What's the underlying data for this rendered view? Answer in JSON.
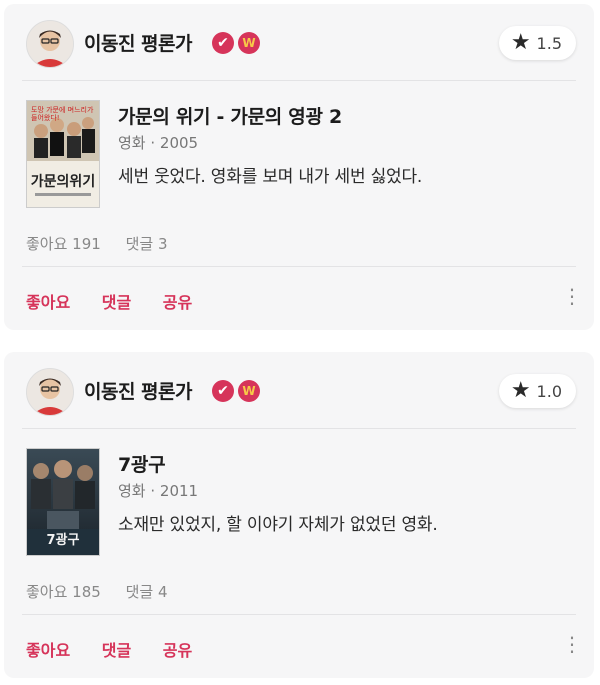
{
  "reviews": [
    {
      "author": "이동진 평론가",
      "badge_check": "✔",
      "badge_w": "W",
      "rating": "1.5",
      "movie_title": "가문의 위기 - 가문의 영광 2",
      "movie_meta": "영화 · 2005",
      "review_text": "세번 웃었다. 영화를 보며 내가 세번 싫었다.",
      "likes_label": "좋아요 191",
      "comments_label": "댓글 3",
      "poster_title": "가문의위기",
      "poster_tagline": "도망 가문에 며느리가 들어왔다!"
    },
    {
      "author": "이동진 평론가",
      "badge_check": "✔",
      "badge_w": "W",
      "rating": "1.0",
      "movie_title": "7광구",
      "movie_meta": "영화 · 2011",
      "review_text": "소재만 있었지, 할 이야기 자체가 없었던 영화.",
      "likes_label": "좋아요 185",
      "comments_label": "댓글 4",
      "poster_title": "7광구"
    }
  ],
  "actions": {
    "like": "좋아요",
    "comment": "댓글",
    "share": "공유"
  },
  "icons": {
    "rating": "star-icon",
    "more": "more-vertical-icon"
  },
  "colors": {
    "accent": "#d6345a",
    "card_bg": "#f6f6f7"
  }
}
